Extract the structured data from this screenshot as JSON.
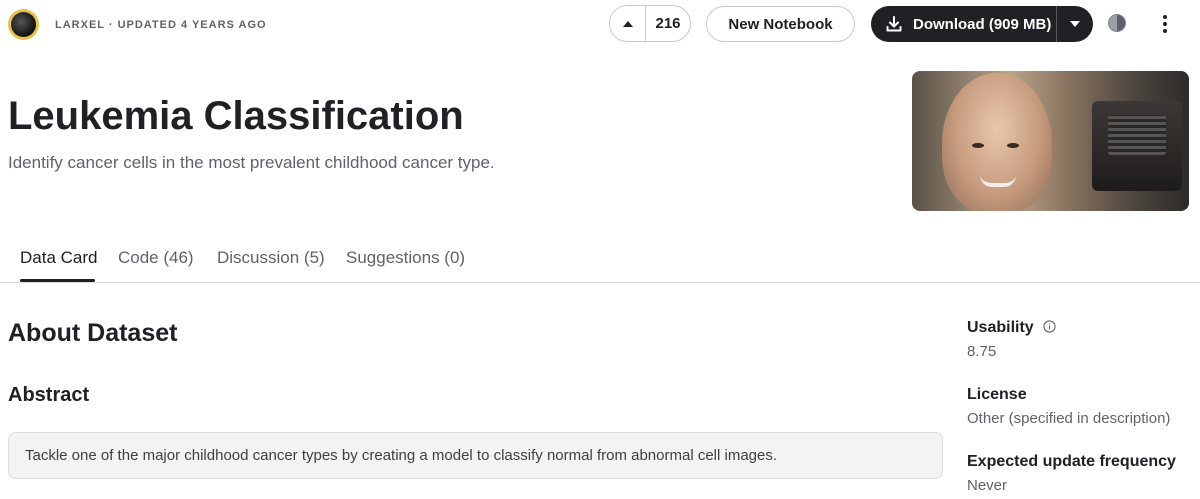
{
  "header": {
    "owner_line": "LARXEL · UPDATED 4 YEARS AGO",
    "vote_count": "216",
    "new_notebook_label": "New Notebook",
    "download_label": "Download (909 MB)",
    "icons": [
      "avatar",
      "upvote-arrow-icon",
      "download-icon",
      "chevron-down-icon",
      "theme-toggle-icon",
      "more-vert-icon"
    ]
  },
  "dataset": {
    "title": "Leukemia Classification",
    "subtitle": "Identify cancer cells in the most prevalent childhood cancer type."
  },
  "tabs": [
    {
      "label": "Data Card",
      "active": true
    },
    {
      "label": "Code (46)",
      "active": false
    },
    {
      "label": "Discussion (5)",
      "active": false
    },
    {
      "label": "Suggestions (0)",
      "active": false
    }
  ],
  "main": {
    "about_heading": "About Dataset",
    "abstract_heading": "Abstract",
    "abstract_text": "Tackle one of the major childhood cancer types by creating a model to classify normal from abnormal cell images."
  },
  "sidebar": {
    "usability_label": "Usability",
    "usability_value": "8.75",
    "license_label": "License",
    "license_value": "Other (specified in description)",
    "update_label": "Expected update frequency",
    "update_value": "Never"
  },
  "colors": {
    "primary_dark": "#202124",
    "secondary_text": "#5f6368",
    "border": "#dadce0",
    "abstract_bg": "#f1f3f4"
  }
}
